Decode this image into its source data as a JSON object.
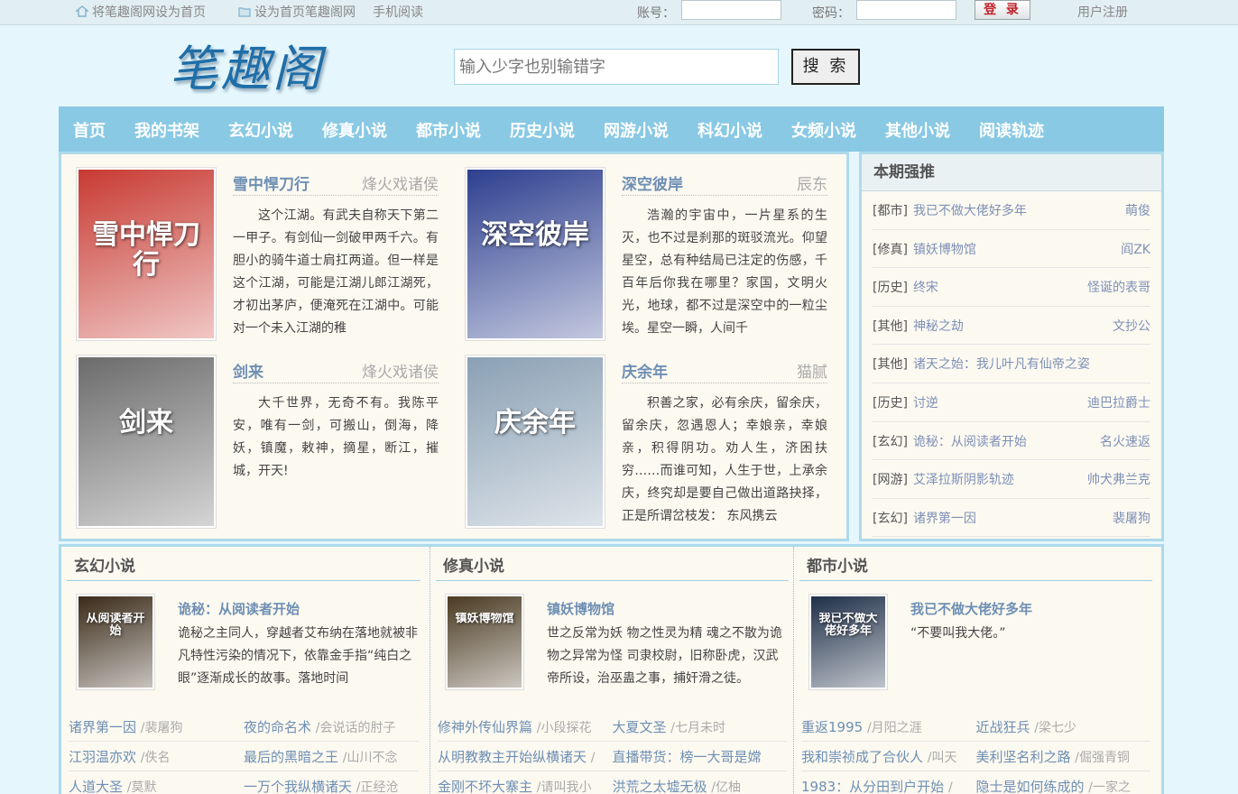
{
  "topbar": {
    "set_home": "将笔趣阁网设为首页",
    "bookmark": "设为首页笔趣阁网",
    "mobile": "手机阅读",
    "account_label": "账号：",
    "password_label": "密码：",
    "login": "登 录",
    "register": "用户注册"
  },
  "header": {
    "logo": "笔趣阁",
    "search_placeholder": "输入少字也别输错字",
    "search_button": "搜 索"
  },
  "nav": [
    "首页",
    "我的书架",
    "玄幻小说",
    "修真小说",
    "都市小说",
    "历史小说",
    "网游小说",
    "科幻小说",
    "女频小说",
    "其他小说",
    "阅读轨迹"
  ],
  "featured": [
    {
      "title": "雪中悍刀行",
      "author": "烽火戏诸侯",
      "desc": "这个江湖。有武夫自称天下第二一甲子。有剑仙一剑破甲两千六。有胆小的骑牛道士肩扛两道。但一样是这个江湖，可能是江湖儿郎江湖死，才初出茅庐，便淹死在江湖中。可能对一个未入江湖的稚",
      "cover_text": "雪中悍刀行",
      "cover_color": "#c83a32"
    },
    {
      "title": "深空彼岸",
      "author": "辰东",
      "desc": "浩瀚的宇宙中，一片星系的生灭，也不过是刹那的斑驳流光。仰望星空，总有种结局已注定的伤感，千百年后你我在哪里？家国，文明火光，地球，都不过是深空中的一粒尘埃。星空一瞬，人间千",
      "cover_text": "深空彼岸",
      "cover_color": "#2d3f8f"
    },
    {
      "title": "剑来",
      "author": "烽火戏诸侯",
      "desc": "大千世界，无奇不有。我陈平安，唯有一剑，可搬山，倒海，降妖，镇魔，敕神，摘星，断江，摧城，开天!",
      "cover_text": "剑来",
      "cover_color": "#6b6b6b"
    },
    {
      "title": "庆余年",
      "author": "猫腻",
      "desc": "积善之家，必有余庆，留余庆，留余庆，忽遇恩人；幸娘亲，幸娘亲，积得阴功。劝人生，济困扶穷……而谁可知，人生于世，上承余庆，终究却是要自己做出道路抉择，正是所谓岔枝发： 东风携云",
      "cover_text": "庆余年",
      "cover_color": "#8aa0b4"
    }
  ],
  "rank": {
    "heading": "本期强推",
    "items": [
      {
        "cat": "[都市]",
        "book": "我已不做大佬好多年",
        "author": "萌俊"
      },
      {
        "cat": "[修真]",
        "book": "镇妖博物馆",
        "author": "阎ZK"
      },
      {
        "cat": "[历史]",
        "book": "终宋",
        "author": "怪诞的表哥"
      },
      {
        "cat": "[其他]",
        "book": "神秘之劫",
        "author": "文抄公"
      },
      {
        "cat": "[其他]",
        "book": "诸天之始：我儿叶凡有仙帝之姿",
        "author": ""
      },
      {
        "cat": "[历史]",
        "book": "讨逆",
        "author": "迪巴拉爵士"
      },
      {
        "cat": "[玄幻]",
        "book": "诡秘：从阅读者开始",
        "author": "名火速返"
      },
      {
        "cat": "[网游]",
        "book": "艾泽拉斯阴影轨迹",
        "author": "帅犬弗兰克"
      },
      {
        "cat": "[玄幻]",
        "book": "诸界第一因",
        "author": "裴屠狗"
      }
    ]
  },
  "categories": [
    {
      "heading": "玄幻小说",
      "top_title": "诡秘：从阅读者开始",
      "top_desc": "诡秘之主同人，穿越者艾布纳在落地就被非凡特性污染的情况下，依靠金手指“纯白之眼”逐渐成长的故事。落地时间",
      "cover_text": "从阅读者开始",
      "cover_color": "#3a2a18",
      "rows": [
        [
          {
            "b": "诸界第一因",
            "a": "/裴屠狗"
          },
          {
            "b": "夜的命名术",
            "a": "/会说话的肘子"
          }
        ],
        [
          {
            "b": "江羽温亦欢",
            "a": "/佚名"
          },
          {
            "b": "最后的黑暗之王",
            "a": "/山川不念"
          }
        ],
        [
          {
            "b": "人道大圣",
            "a": "/莫默"
          },
          {
            "b": "一万个我纵横诸天",
            "a": "/正经沧"
          }
        ]
      ]
    },
    {
      "heading": "修真小说",
      "top_title": "镇妖博物馆",
      "top_desc": "世之反常为妖 物之性灵为精 魂之不散为诡 物之异常为怪 司隶校尉，旧称卧虎，汉武帝所设，治巫蛊之事，捕奸滑之徒。",
      "cover_text": "镇妖博物馆",
      "cover_color": "#4a3a22",
      "rows": [
        [
          {
            "b": "修神外传仙界篇",
            "a": "/小段探花"
          },
          {
            "b": "大夏文圣",
            "a": "/七月未时"
          }
        ],
        [
          {
            "b": "从明教教主开始纵横诸天",
            "a": "/"
          },
          {
            "b": "直播带货：榜一大哥是嫦",
            "a": ""
          }
        ],
        [
          {
            "b": "金刚不坏大寨主",
            "a": "/请叫我小"
          },
          {
            "b": "洪荒之太墟无极",
            "a": "/亿柚"
          }
        ]
      ]
    },
    {
      "heading": "都市小说",
      "top_title": "我已不做大佬好多年",
      "top_desc": "“不要叫我大佬。”",
      "cover_text": "我已不做大佬好多年",
      "cover_color": "#1e2f48",
      "rows": [
        [
          {
            "b": "重返1995",
            "a": "/月阳之涯"
          },
          {
            "b": "近战狂兵",
            "a": "/梁七少"
          }
        ],
        [
          {
            "b": "我和崇祯成了合伙人",
            "a": "/叫天"
          },
          {
            "b": "美利坚名利之路",
            "a": "/倔强青铜"
          }
        ],
        [
          {
            "b": "1983：从分田到户开始",
            "a": "/"
          },
          {
            "b": "隐士是如何练成的",
            "a": "/一家之"
          }
        ]
      ]
    }
  ],
  "colors": {
    "nav_bg": "#89c9e4",
    "page_bg": "#e5f7fd",
    "panel_bg": "#fcf9f0",
    "link": "#6e8fb4"
  }
}
